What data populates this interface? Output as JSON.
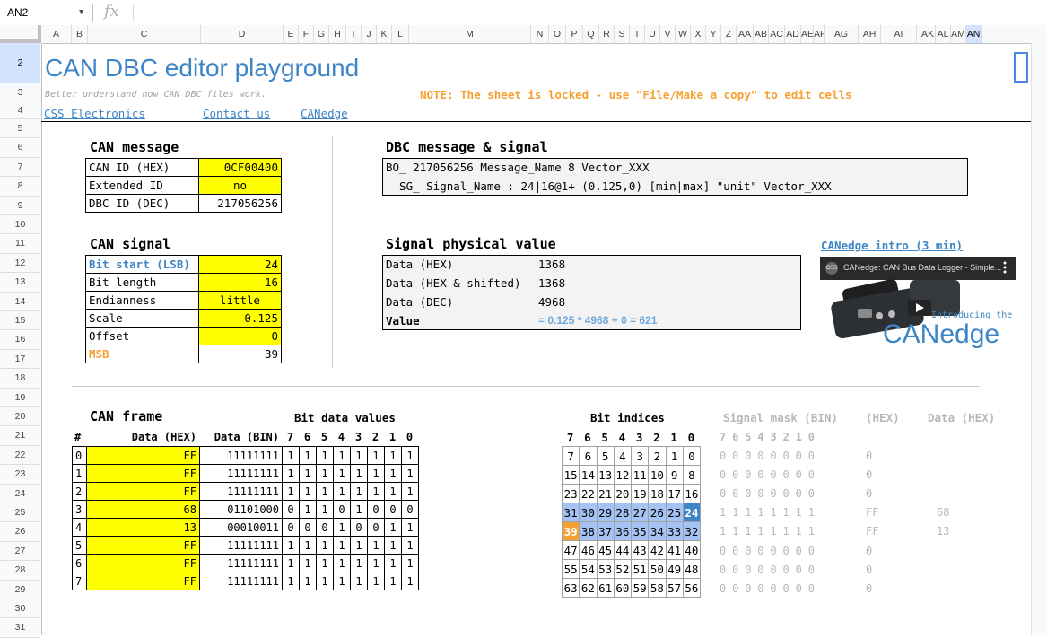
{
  "formula_bar": {
    "cell_ref": "AN2",
    "fx": "fx"
  },
  "columns": [
    "A",
    "B",
    "C",
    "D",
    "E",
    "F",
    "G",
    "H",
    "I",
    "J",
    "K",
    "L",
    "M",
    "N",
    "O",
    "P",
    "Q",
    "R",
    "S",
    "T",
    "U",
    "V",
    "W",
    "X",
    "Y",
    "Z",
    "AA",
    "AB",
    "AC",
    "AD",
    "AE",
    "AF",
    "AG",
    "AH",
    "AI",
    "AK",
    "AL",
    "AM",
    "AN"
  ],
  "rows": [
    "2",
    "3",
    "4",
    "5",
    "6",
    "7",
    "8",
    "9",
    "10",
    "11",
    "12",
    "13",
    "14",
    "15",
    "16",
    "17",
    "18",
    "19",
    "20",
    "21",
    "22",
    "23",
    "24",
    "25",
    "26",
    "27",
    "28",
    "29",
    "30",
    "31"
  ],
  "header": {
    "title": "CAN DBC editor playground",
    "subtitle": "Better understand how CAN DBC files work.",
    "note": "NOTE: The sheet is locked - use \"File/Make a copy\" to edit cells",
    "links": [
      "CSS Electronics",
      "Contact us",
      "CANedge"
    ]
  },
  "can_message": {
    "title": "CAN message",
    "rows": [
      {
        "label": "CAN ID (HEX)",
        "value": "0CF00400"
      },
      {
        "label": "Extended ID",
        "value": "no"
      },
      {
        "label": "DBC ID (DEC)",
        "value": "217056256"
      }
    ]
  },
  "can_signal": {
    "title": "CAN signal",
    "rows": [
      {
        "label": "Bit start (LSB)",
        "value": "24"
      },
      {
        "label": "Bit length",
        "value": "16"
      },
      {
        "label": "Endianness",
        "value": "little"
      },
      {
        "label": "Scale",
        "value": "0.125"
      },
      {
        "label": "Offset",
        "value": "0"
      },
      {
        "label": "MSB",
        "value": "39"
      }
    ]
  },
  "dbc": {
    "title": "DBC message & signal",
    "line1": "BO_ 217056256 Message_Name 8 Vector_XXX",
    "line2": "  SG_ Signal_Name : 24|16@1+ (0.125,0) [min|max] \"unit\" Vector_XXX"
  },
  "physical": {
    "title": "Signal physical value",
    "rows": [
      {
        "label": "Data (HEX)",
        "value": "1368"
      },
      {
        "label": "Data (HEX & shifted)",
        "value": "1368"
      },
      {
        "label": "Data (DEC)",
        "value": "4968"
      },
      {
        "label": "Value",
        "value": "= 0.125 * 4968 + 0 = 621"
      }
    ]
  },
  "video": {
    "link": "CANedge intro (3 min)",
    "title": "CANedge: CAN Bus Data Logger - Simple...",
    "logo": "CSS",
    "caption": "Introducing the",
    "brand": "CANedge"
  },
  "can_frame": {
    "title": "CAN frame",
    "bit_values_title": "Bit data values",
    "headers": {
      "index": "#",
      "hex": "Data (HEX)",
      "bin": "Data (BIN)"
    },
    "bit_labels": [
      "7",
      "6",
      "5",
      "4",
      "3",
      "2",
      "1",
      "0"
    ],
    "rows": [
      {
        "i": "0",
        "hex": "FF",
        "bin": "11111111",
        "bits": [
          "1",
          "1",
          "1",
          "1",
          "1",
          "1",
          "1",
          "1"
        ]
      },
      {
        "i": "1",
        "hex": "FF",
        "bin": "11111111",
        "bits": [
          "1",
          "1",
          "1",
          "1",
          "1",
          "1",
          "1",
          "1"
        ]
      },
      {
        "i": "2",
        "hex": "FF",
        "bin": "11111111",
        "bits": [
          "1",
          "1",
          "1",
          "1",
          "1",
          "1",
          "1",
          "1"
        ]
      },
      {
        "i": "3",
        "hex": "68",
        "bin": "01101000",
        "bits": [
          "0",
          "1",
          "1",
          "0",
          "1",
          "0",
          "0",
          "0"
        ]
      },
      {
        "i": "4",
        "hex": "13",
        "bin": "00010011",
        "bits": [
          "0",
          "0",
          "0",
          "1",
          "0",
          "0",
          "1",
          "1"
        ]
      },
      {
        "i": "5",
        "hex": "FF",
        "bin": "11111111",
        "bits": [
          "1",
          "1",
          "1",
          "1",
          "1",
          "1",
          "1",
          "1"
        ]
      },
      {
        "i": "6",
        "hex": "FF",
        "bin": "11111111",
        "bits": [
          "1",
          "1",
          "1",
          "1",
          "1",
          "1",
          "1",
          "1"
        ]
      },
      {
        "i": "7",
        "hex": "FF",
        "bin": "11111111",
        "bits": [
          "1",
          "1",
          "1",
          "1",
          "1",
          "1",
          "1",
          "1"
        ]
      }
    ]
  },
  "bit_indices": {
    "title": "Bit indices",
    "labels": [
      "7",
      "6",
      "5",
      "4",
      "3",
      "2",
      "1",
      "0"
    ],
    "rows": [
      [
        "7",
        "6",
        "5",
        "4",
        "3",
        "2",
        "1",
        "0"
      ],
      [
        "15",
        "14",
        "13",
        "12",
        "11",
        "10",
        "9",
        "8"
      ],
      [
        "23",
        "22",
        "21",
        "20",
        "19",
        "18",
        "17",
        "16"
      ],
      [
        "31",
        "30",
        "29",
        "28",
        "27",
        "26",
        "25",
        "24"
      ],
      [
        "39",
        "38",
        "37",
        "36",
        "35",
        "34",
        "33",
        "32"
      ],
      [
        "47",
        "46",
        "45",
        "44",
        "43",
        "42",
        "41",
        "40"
      ],
      [
        "55",
        "54",
        "53",
        "52",
        "51",
        "50",
        "49",
        "48"
      ],
      [
        "63",
        "62",
        "61",
        "60",
        "59",
        "58",
        "57",
        "56"
      ]
    ],
    "selected_rows": [
      3,
      4
    ],
    "lsb": "24",
    "msb": "39"
  },
  "signal_mask": {
    "title": "Signal mask (BIN)",
    "hex_title": "(HEX)",
    "data_title": "Data (HEX)",
    "labels": [
      "7",
      "6",
      "5",
      "4",
      "3",
      "2",
      "1",
      "0"
    ],
    "rows": [
      {
        "bits": [
          "0",
          "0",
          "0",
          "0",
          "0",
          "0",
          "0",
          "0"
        ],
        "hex": "0",
        "data": ""
      },
      {
        "bits": [
          "0",
          "0",
          "0",
          "0",
          "0",
          "0",
          "0",
          "0"
        ],
        "hex": "0",
        "data": ""
      },
      {
        "bits": [
          "0",
          "0",
          "0",
          "0",
          "0",
          "0",
          "0",
          "0"
        ],
        "hex": "0",
        "data": ""
      },
      {
        "bits": [
          "1",
          "1",
          "1",
          "1",
          "1",
          "1",
          "1",
          "1"
        ],
        "hex": "FF",
        "data": "68"
      },
      {
        "bits": [
          "1",
          "1",
          "1",
          "1",
          "1",
          "1",
          "1",
          "1"
        ],
        "hex": "FF",
        "data": "13"
      },
      {
        "bits": [
          "0",
          "0",
          "0",
          "0",
          "0",
          "0",
          "0",
          "0"
        ],
        "hex": "0",
        "data": ""
      },
      {
        "bits": [
          "0",
          "0",
          "0",
          "0",
          "0",
          "0",
          "0",
          "0"
        ],
        "hex": "0",
        "data": ""
      },
      {
        "bits": [
          "0",
          "0",
          "0",
          "0",
          "0",
          "0",
          "0",
          "0"
        ],
        "hex": "0",
        "data": ""
      }
    ]
  },
  "colors": {
    "accent": "#3d85c6",
    "highlight": "#ffff00",
    "orange": "#f6a030",
    "selection": "#a4c2f4"
  }
}
